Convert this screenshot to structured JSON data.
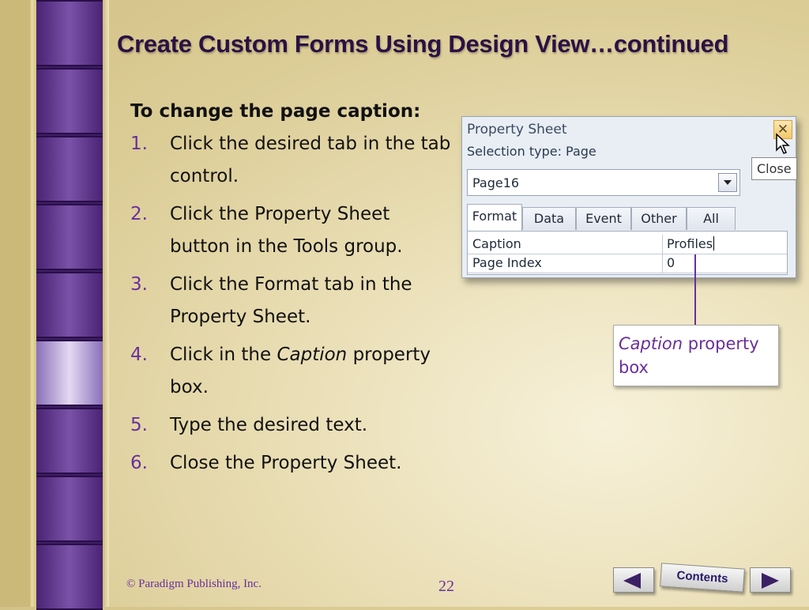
{
  "slide": {
    "title": "Create Custom Forms Using Design View…continued",
    "heading": "To change the page caption:",
    "steps": [
      {
        "num": "1.",
        "text": "Click the desired tab in the tab control."
      },
      {
        "num": "2.",
        "text": "Click the Property Sheet button in the Tools group."
      },
      {
        "num": "3.",
        "text": "Click the Format tab in the Property Sheet."
      },
      {
        "num": "4.",
        "text_before": "Click in the ",
        "text_italic": "Caption",
        "text_after": " property box."
      },
      {
        "num": "5.",
        "text": "Type the desired text."
      },
      {
        "num": "6.",
        "text": "Close the Property Sheet."
      }
    ]
  },
  "property_sheet": {
    "title": "Property Sheet",
    "close_glyph": "✕",
    "tooltip": "Close",
    "selection_type": "Selection type:  Page",
    "combo_value": "Page16",
    "tabs": [
      "Format",
      "Data",
      "Event",
      "Other",
      "All"
    ],
    "rows": [
      {
        "key": "Caption",
        "value": "Profiles"
      },
      {
        "key": "Page Index",
        "value": "0"
      }
    ]
  },
  "callout": {
    "italic": "Caption",
    "rest": " property box"
  },
  "footer": {
    "copyright": "© Paradigm Publishing, Inc.",
    "page_number": "22",
    "contents_label": "Contents"
  }
}
